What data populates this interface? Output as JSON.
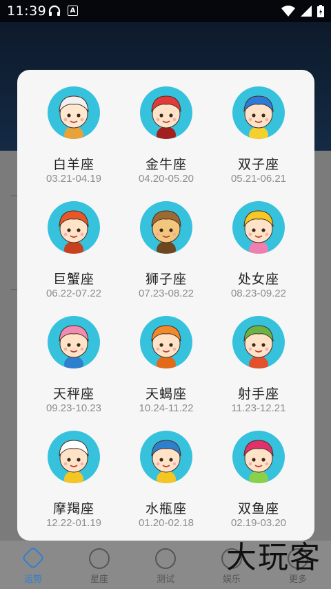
{
  "status_bar": {
    "time": "11:39",
    "badge": "A"
  },
  "zodiac_signs": [
    {
      "name": "白羊座",
      "dates": "03.21-04.19",
      "icon": "aries-cartoon-icon",
      "hair": "#f1f1f1",
      "skin": "#ffe8cf",
      "acc": "#e8a23a"
    },
    {
      "name": "金牛座",
      "dates": "04.20-05.20",
      "icon": "taurus-cartoon-icon",
      "hair": "#e23a3a",
      "skin": "#ffe3c9",
      "acc": "#a22020"
    },
    {
      "name": "双子座",
      "dates": "05.21-06.21",
      "icon": "gemini-cartoon-icon",
      "hair": "#2d7ad8",
      "skin": "#ffe3c9",
      "acc": "#f5cf2b"
    },
    {
      "name": "巨蟹座",
      "dates": "06.22-07.22",
      "icon": "cancer-cartoon-icon",
      "hair": "#e7572a",
      "skin": "#ffe3c9",
      "acc": "#c8401c"
    },
    {
      "name": "狮子座",
      "dates": "07.23-08.22",
      "icon": "leo-cartoon-icon",
      "hair": "#9c6a33",
      "skin": "#f3c67e",
      "acc": "#6e4620"
    },
    {
      "name": "处女座",
      "dates": "08.23-09.22",
      "icon": "virgo-cartoon-icon",
      "hair": "#f7c823",
      "skin": "#ffe3c9",
      "acc": "#f07fb1"
    },
    {
      "name": "天秤座",
      "dates": "09.23-10.23",
      "icon": "libra-cartoon-icon",
      "hair": "#f18bb3",
      "skin": "#ffe3c9",
      "acc": "#2f7fcf"
    },
    {
      "name": "天蝎座",
      "dates": "10.24-11.22",
      "icon": "scorpio-cartoon-icon",
      "hair": "#f08a2c",
      "skin": "#ffe3c9",
      "acc": "#e26a1a"
    },
    {
      "name": "射手座",
      "dates": "11.23-12.21",
      "icon": "sagittarius-cartoon-icon",
      "hair": "#6ab445",
      "skin": "#ffe3c9",
      "acc": "#e3502c"
    },
    {
      "name": "摩羯座",
      "dates": "12.22-01.19",
      "icon": "capricorn-cartoon-icon",
      "hair": "#ffffff",
      "skin": "#ffe3c9",
      "acc": "#f3c623"
    },
    {
      "name": "水瓶座",
      "dates": "01.20-02.18",
      "icon": "aquarius-cartoon-icon",
      "hair": "#2f7fcf",
      "skin": "#ffe3c9",
      "acc": "#f3c623"
    },
    {
      "name": "双鱼座",
      "dates": "02.19-03.20",
      "icon": "pisces-cartoon-icon",
      "hair": "#e2306b",
      "skin": "#ffe3c9",
      "acc": "#8ad14a"
    }
  ],
  "bottom_nav": [
    {
      "label": "运势",
      "icon": "fortune-icon",
      "active": true
    },
    {
      "label": "星座",
      "icon": "constellation-icon",
      "active": false
    },
    {
      "label": "测试",
      "icon": "quiz-icon",
      "active": false
    },
    {
      "label": "娱乐",
      "icon": "entertainment-icon",
      "active": false
    },
    {
      "label": "更多",
      "icon": "more-icon",
      "active": false
    }
  ],
  "watermark": "大玩客",
  "colors": {
    "avatar_bg": "#36c2dd",
    "active_nav": "#2f7fcf",
    "card_bg": "#f6f6f6"
  }
}
